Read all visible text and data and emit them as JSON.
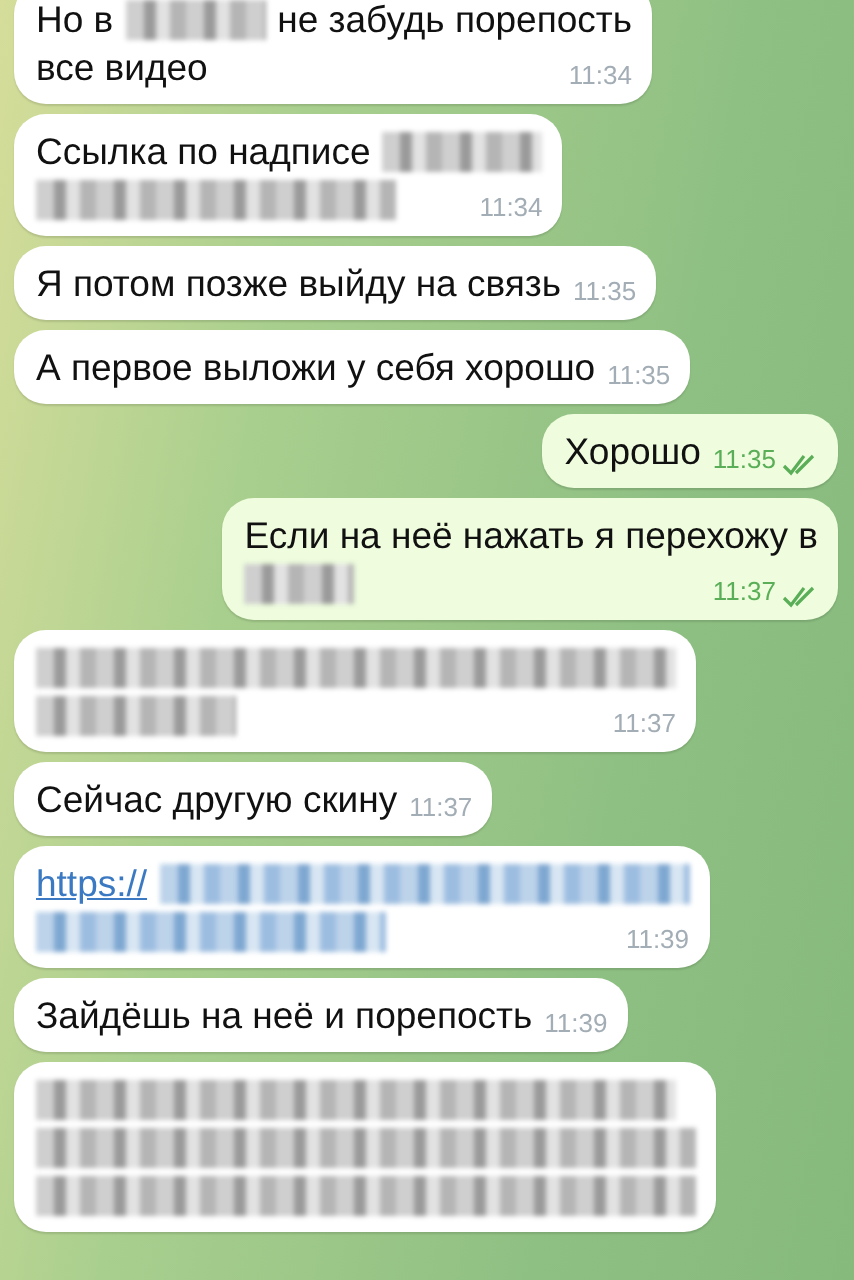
{
  "messages": [
    {
      "outgoing": false,
      "time": "11:34",
      "lines": [
        [
          {
            "kind": "text",
            "text": "Но в"
          },
          {
            "kind": "redacted"
          },
          {
            "kind": "text",
            "text": "не забудь порепость"
          }
        ],
        [
          {
            "kind": "text",
            "text": "все видео"
          }
        ]
      ]
    },
    {
      "outgoing": false,
      "time": "11:34",
      "lines": [
        [
          {
            "kind": "text",
            "text": "Ссылка по надписе"
          },
          {
            "kind": "redacted"
          }
        ],
        [
          {
            "kind": "redacted"
          }
        ]
      ]
    },
    {
      "outgoing": false,
      "time": "11:35",
      "lines": [
        [
          {
            "kind": "text",
            "text": "Я потом позже выйду на связь"
          }
        ]
      ]
    },
    {
      "outgoing": false,
      "time": "11:35",
      "lines": [
        [
          {
            "kind": "text",
            "text": "А первое выложи у себя хорошо"
          }
        ]
      ]
    },
    {
      "outgoing": true,
      "read": true,
      "time": "11:35",
      "lines": [
        [
          {
            "kind": "text",
            "text": "Хорошо"
          }
        ]
      ]
    },
    {
      "outgoing": true,
      "read": true,
      "time": "11:37",
      "lines": [
        [
          {
            "kind": "text",
            "text": "Если на неё нажать я перехожу в"
          }
        ],
        [
          {
            "kind": "redacted"
          }
        ]
      ]
    },
    {
      "outgoing": false,
      "time": "11:37",
      "lines": [
        [
          {
            "kind": "redacted"
          }
        ],
        [
          {
            "kind": "redacted"
          }
        ]
      ]
    },
    {
      "outgoing": false,
      "time": "11:37",
      "lines": [
        [
          {
            "kind": "text",
            "text": "Сейчас другую скину"
          }
        ]
      ]
    },
    {
      "outgoing": false,
      "time": "11:39",
      "lines": [
        [
          {
            "kind": "link",
            "text": "https://"
          },
          {
            "kind": "redacted-link"
          }
        ],
        [
          {
            "kind": "redacted-link"
          }
        ]
      ]
    },
    {
      "outgoing": false,
      "time": "11:39",
      "lines": [
        [
          {
            "kind": "text",
            "text": "Зайдёшь на неё и порепость"
          }
        ]
      ]
    },
    {
      "outgoing": false,
      "lines": [
        [
          {
            "kind": "redacted"
          }
        ],
        [
          {
            "kind": "redacted"
          }
        ],
        [
          {
            "kind": "redacted"
          }
        ]
      ]
    }
  ]
}
